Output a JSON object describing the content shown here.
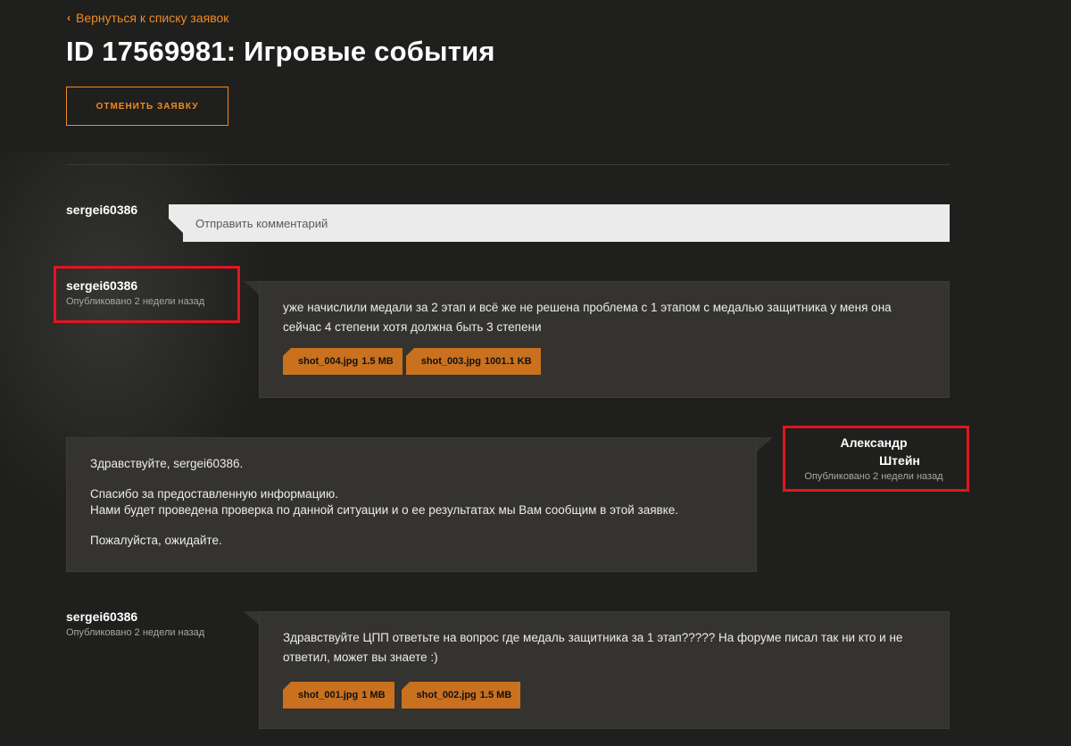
{
  "nav": {
    "back_label": "Вернуться к списку заявок"
  },
  "page": {
    "title": "ID 17569981: Игровые события"
  },
  "actions": {
    "cancel_label": "ОТМЕНИТЬ ЗАЯВКУ"
  },
  "reply": {
    "user": "sergei60386",
    "placeholder": "Отправить комментарий"
  },
  "comments": [
    {
      "author": "sergei60386",
      "published": "Опубликовано 2 недели назад",
      "lines": [
        "уже начислили медали за 2 этап и всё же не решена проблема с 1 этапом с медалью защитника у меня она",
        "сейчас 4 степени хотя должна быть 3 степени"
      ],
      "attachments": [
        {
          "name": "shot_004.jpg",
          "size": "1.5 MB"
        },
        {
          "name": "shot_003.jpg",
          "size": "1001.1 KB"
        }
      ]
    },
    {
      "author_line1": "Александр",
      "author_line2": "Штейн",
      "published": "Опубликовано 2 недели назад",
      "greeting": "Здравствуйте, sergei60386.",
      "para1_line1": "Спасибо за предоставленную информацию.",
      "para1_line2": "Нами будет проведена проверка по данной ситуации и о ее результатах мы Вам сообщим в этой заявке.",
      "closing": "Пожалуйста, ожидайте."
    },
    {
      "author": "sergei60386",
      "published": "Опубликовано 2 недели назад",
      "lines": [
        "Здравствуйте ЦПП ответьте на вопрос где медаль защитника за 1 этап????? На форуме писал так ни кто и не",
        "ответил, может вы знаете :)"
      ],
      "attachments": [
        {
          "name": "shot_001.jpg",
          "size": "1 MB"
        },
        {
          "name": "shot_002.jpg",
          "size": "1.5 MB"
        }
      ]
    }
  ],
  "colors": {
    "accent": "#f08a24",
    "attachment": "#c9711f",
    "highlight": "#e0161f",
    "bubble": "#34332f",
    "background": "#1f1f1d"
  }
}
